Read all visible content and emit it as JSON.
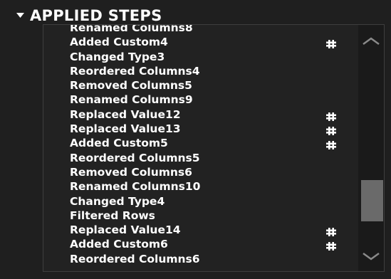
{
  "header": {
    "title": "APPLIED STEPS",
    "collapse_icon": "triangle-down-icon"
  },
  "steps": [
    {
      "label": "Renamed Columns8",
      "has_settings": false
    },
    {
      "label": "Added Custom4",
      "has_settings": true
    },
    {
      "label": "Changed Type3",
      "has_settings": false
    },
    {
      "label": "Reordered Columns4",
      "has_settings": false
    },
    {
      "label": "Removed Columns5",
      "has_settings": false
    },
    {
      "label": "Renamed Columns9",
      "has_settings": false
    },
    {
      "label": "Replaced Value12",
      "has_settings": true
    },
    {
      "label": "Replaced Value13",
      "has_settings": true
    },
    {
      "label": "Added Custom5",
      "has_settings": true
    },
    {
      "label": "Reordered Columns5",
      "has_settings": false
    },
    {
      "label": "Removed Columns6",
      "has_settings": false
    },
    {
      "label": "Renamed Columns10",
      "has_settings": false
    },
    {
      "label": "Changed Type4",
      "has_settings": false
    },
    {
      "label": "Filtered Rows",
      "has_settings": false
    },
    {
      "label": "Replaced Value14",
      "has_settings": true
    },
    {
      "label": "Added Custom6",
      "has_settings": true
    },
    {
      "label": "Reordered Columns6",
      "has_settings": false
    }
  ],
  "icons": {
    "step_settings": "gear-icon",
    "scroll_up": "chevron-up-icon",
    "scroll_down": "chevron-down-icon"
  },
  "colors": {
    "background": "#1f1f1f",
    "text": "#ffffff",
    "scroll_thumb": "#6a6a6a"
  }
}
